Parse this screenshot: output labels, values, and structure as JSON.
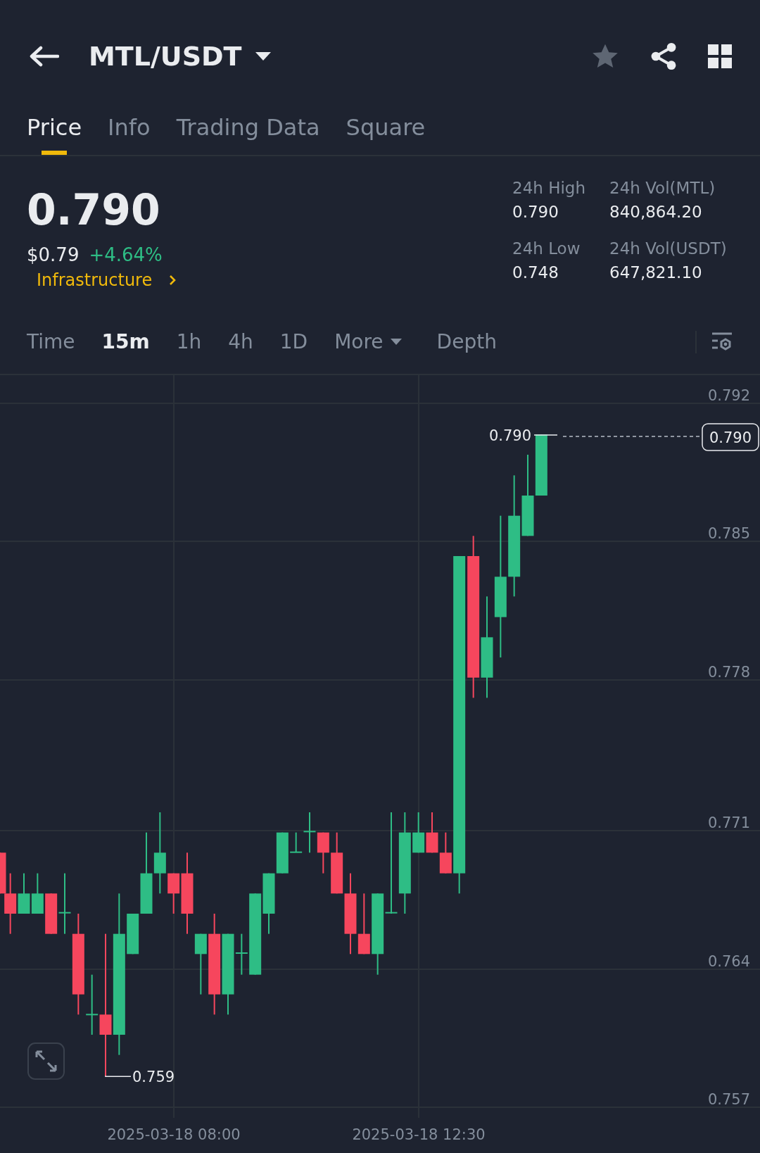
{
  "header": {
    "pair": "MTL/USDT"
  },
  "tabs": [
    {
      "label": "Price",
      "selected": true
    },
    {
      "label": "Info",
      "selected": false
    },
    {
      "label": "Trading Data",
      "selected": false
    },
    {
      "label": "Square",
      "selected": false
    }
  ],
  "summary": {
    "last_price": "0.790",
    "usd_price": "$0.79",
    "change": "+4.64%",
    "category": "Infrastructure"
  },
  "stats": [
    {
      "label": "24h High",
      "value": "0.790"
    },
    {
      "label": "24h Vol(MTL)",
      "value": "840,864.20"
    },
    {
      "label": "24h Low",
      "value": "0.748"
    },
    {
      "label": "24h Vol(USDT)",
      "value": "647,821.10"
    }
  ],
  "intervals": [
    {
      "label": "Time",
      "selected": false,
      "kind": "option"
    },
    {
      "label": "15m",
      "selected": true,
      "kind": "option"
    },
    {
      "label": "1h",
      "selected": false,
      "kind": "option"
    },
    {
      "label": "4h",
      "selected": false,
      "kind": "option"
    },
    {
      "label": "1D",
      "selected": false,
      "kind": "option"
    },
    {
      "label": "More",
      "selected": false,
      "kind": "menu"
    },
    {
      "label": "Depth",
      "selected": false,
      "kind": "option"
    }
  ],
  "chart": {
    "y_ticks": [
      "0.792",
      "0.785",
      "0.778",
      "0.771",
      "0.764",
      "0.757"
    ],
    "x_labels": [
      "2025-03-18 08:00",
      "2025-03-18 12:30"
    ],
    "high_label": "0.790",
    "last_price_tag": "0.790",
    "low_label": "0.759"
  }
}
